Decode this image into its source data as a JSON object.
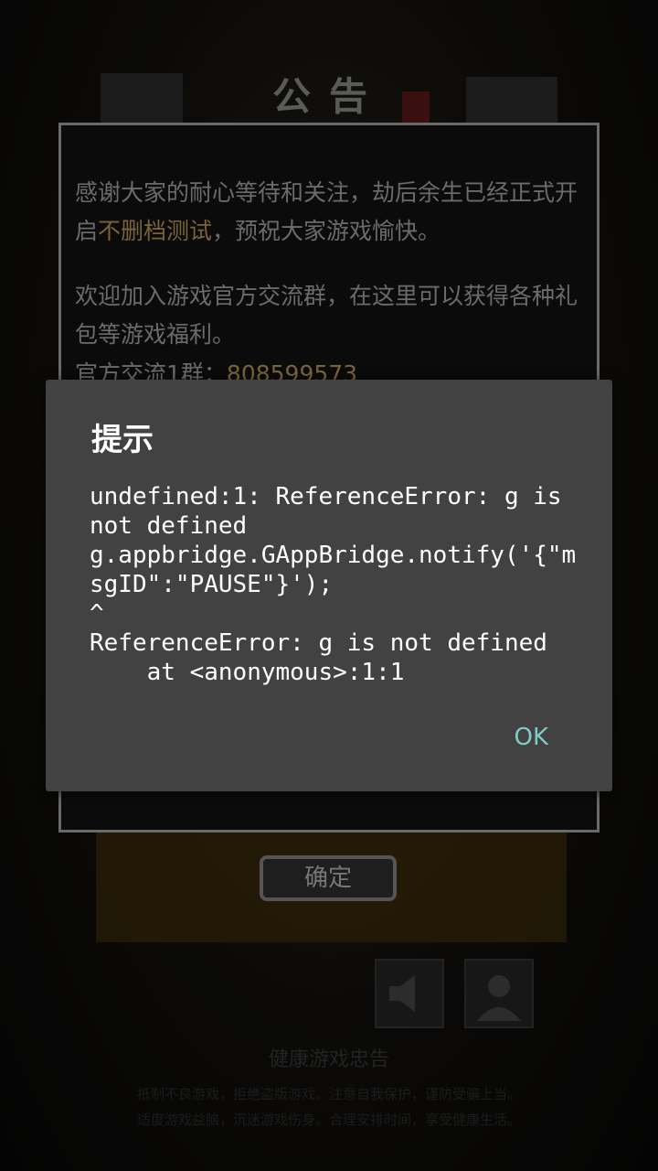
{
  "notice": {
    "title": "公告",
    "p1_before": "感谢大家的耐心等待和关注，劫后余生已经正式开启",
    "p1_highlight": "不删档测试",
    "p1_after": "，预祝大家游戏愉快。",
    "p2": "欢迎加入游戏官方交流群，在这里可以获得各种礼包等游戏福利。",
    "qq_label": "官方交流1群：",
    "qq_number": "808599573",
    "confirm_label": "确定"
  },
  "health": {
    "title": "健康游戏忠告",
    "line1": "抵制不良游戏，拒绝盗版游戏。注意自我保护，谨防受骗上当。",
    "line2": "适度游戏益脑，沉迷游戏伤身。合理安排时间，享受健康生活。"
  },
  "dialog": {
    "title": "提示",
    "message": "undefined:1: ReferenceError: g is not defined\ng.appbridge.GAppBridge.notify('{\"msgID\":\"PAUSE\"}');\n^\nReferenceError: g is not defined\n    at <anonymous>:1:1",
    "ok_label": "OK"
  },
  "colors": {
    "dialog_bg": "#424242",
    "ok_accent": "#80cbc4",
    "highlight": "#7b6338"
  },
  "icons": [
    "speaker-icon",
    "user-icon"
  ]
}
